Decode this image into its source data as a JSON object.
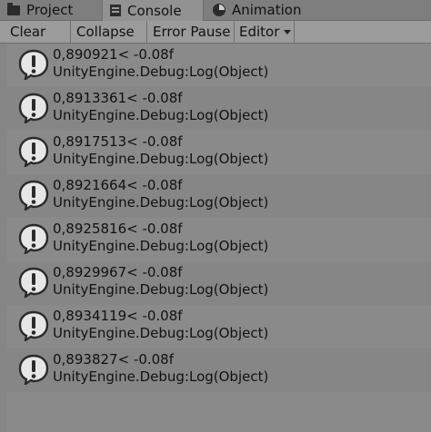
{
  "tabs": [
    {
      "label": "Project",
      "icon": "folder-icon"
    },
    {
      "label": "Console",
      "icon": "console-icon"
    },
    {
      "label": "Animation",
      "icon": "animation-icon"
    }
  ],
  "toolbar": {
    "clear_label": "Clear",
    "collapse_label": "Collapse",
    "error_pause_label": "Error Pause",
    "editor_label": "Editor"
  },
  "logs": [
    {
      "message": "0,890921< -0.08f",
      "stack": "UnityEngine.Debug:Log(Object)"
    },
    {
      "message": "0,8913361< -0.08f",
      "stack": "UnityEngine.Debug:Log(Object)"
    },
    {
      "message": "0,8917513< -0.08f",
      "stack": "UnityEngine.Debug:Log(Object)"
    },
    {
      "message": "0,8921664< -0.08f",
      "stack": "UnityEngine.Debug:Log(Object)"
    },
    {
      "message": "0,8925816< -0.08f",
      "stack": "UnityEngine.Debug:Log(Object)"
    },
    {
      "message": "0,8929967< -0.08f",
      "stack": "UnityEngine.Debug:Log(Object)"
    },
    {
      "message": "0,8934119< -0.08f",
      "stack": "UnityEngine.Debug:Log(Object)"
    },
    {
      "message": "0,893827< -0.08f",
      "stack": "UnityEngine.Debug:Log(Object)"
    }
  ],
  "colors": {
    "background": "#8a8a8a",
    "toolbar": "#9b9b9b",
    "icon_fill": "#e6e6e6",
    "icon_glyph": "#2a2a2a"
  }
}
